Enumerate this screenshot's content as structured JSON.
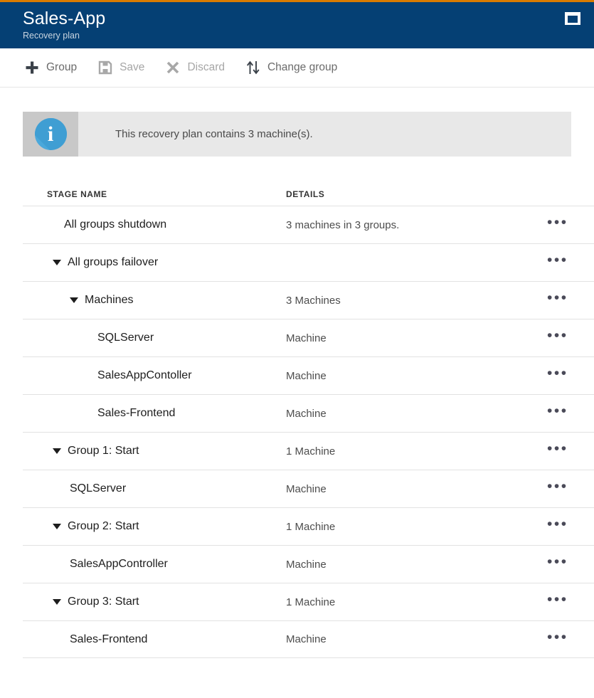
{
  "theme": {
    "accent_bar_color": "#d97b00",
    "header_bg_color": "#054074",
    "info_icon_color": "#4aa8db",
    "banner_bg_color": "#e8e8e8",
    "banner_icon_bg_color": "#c8c8c8"
  },
  "header": {
    "title": "Sales-App",
    "subtitle": "Recovery plan",
    "window_control_icon": "restore-window-icon"
  },
  "toolbar": {
    "commands": [
      {
        "id": "group",
        "label": "Group",
        "icon": "plus-icon",
        "disabled": false
      },
      {
        "id": "save",
        "label": "Save",
        "icon": "floppy-save-icon",
        "disabled": true
      },
      {
        "id": "discard",
        "label": "Discard",
        "icon": "cross-x-icon",
        "disabled": true
      },
      {
        "id": "change-group",
        "label": "Change group",
        "icon": "up-down-arrows-icon",
        "disabled": false
      }
    ]
  },
  "banner": {
    "icon": "info-circle-icon",
    "glyph": "i",
    "message": "This recovery plan contains 3 machine(s)."
  },
  "table": {
    "columns": [
      {
        "id": "stage_name",
        "label": "STAGE NAME"
      },
      {
        "id": "details",
        "label": "DETAILS"
      }
    ],
    "row_menu_glyph": "•••",
    "rows": [
      {
        "name": "All groups shutdown",
        "details": "3 machines in 3 groups.",
        "level": 0,
        "expandable": false,
        "expanded": false
      },
      {
        "name": "All groups failover",
        "details": "",
        "level": 1,
        "expandable": true,
        "expanded": true
      },
      {
        "name": "Machines",
        "details": "3 Machines",
        "level": 2,
        "expandable": true,
        "expanded": true
      },
      {
        "name": "SQLServer",
        "details": "Machine",
        "level": 3,
        "expandable": false,
        "expanded": false
      },
      {
        "name": "SalesAppContoller",
        "details": "Machine",
        "level": 3,
        "expandable": false,
        "expanded": false
      },
      {
        "name": "Sales-Frontend",
        "details": "Machine",
        "level": 3,
        "expandable": false,
        "expanded": false
      },
      {
        "name": "Group 1: Start",
        "details": "1 Machine",
        "level": 1,
        "expandable": true,
        "expanded": true
      },
      {
        "name": "SQLServer",
        "details": "Machine",
        "level": 2,
        "expandable": false,
        "expanded": false
      },
      {
        "name": "Group 2: Start",
        "details": "1 Machine",
        "level": 1,
        "expandable": true,
        "expanded": true
      },
      {
        "name": "SalesAppController",
        "details": "Machine",
        "level": 2,
        "expandable": false,
        "expanded": false
      },
      {
        "name": "Group 3: Start",
        "details": "1 Machine",
        "level": 1,
        "expandable": true,
        "expanded": true
      },
      {
        "name": "Sales-Frontend",
        "details": "Machine",
        "level": 2,
        "expandable": false,
        "expanded": false
      }
    ]
  }
}
